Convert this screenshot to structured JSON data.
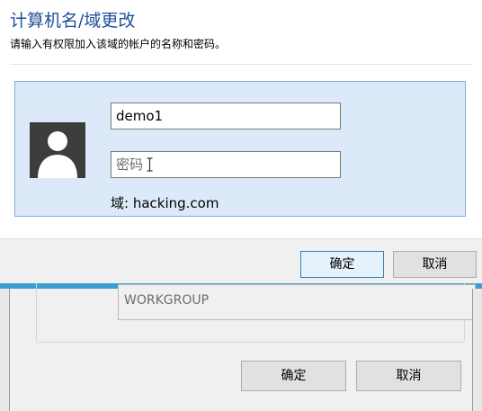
{
  "dialog": {
    "title": "计算机名/域更改",
    "subtitle": "请输入有权限加入该域的帐户的名称和密码。",
    "username": "demo1",
    "password_placeholder": "密码",
    "domain_line": "域: hacking.com",
    "ok_label": "确定",
    "cancel_label": "取消"
  },
  "background_window": {
    "workgroup_value": "WORKGROUP",
    "ok_label": "确定",
    "cancel_label": "取消"
  },
  "icons": {
    "avatar": "user-avatar-icon",
    "cursor": "text-cursor-icon"
  },
  "colors": {
    "title": "#1f4e9c",
    "credential_panel": "#dce9f9",
    "accent_bar": "#3a9fd2"
  }
}
